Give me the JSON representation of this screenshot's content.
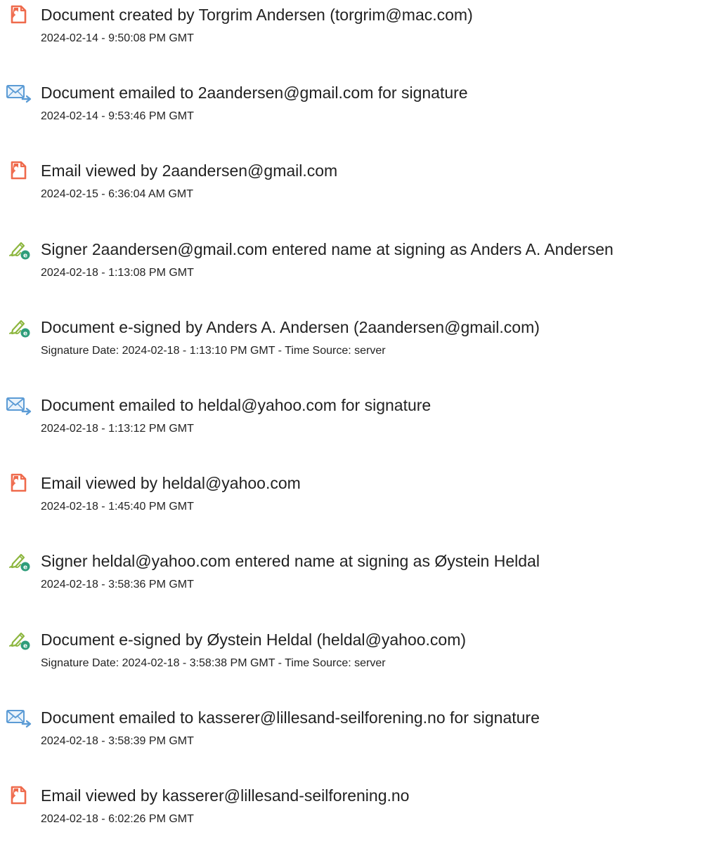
{
  "colors": {
    "doc_icon": "#ef6a4c",
    "mail_icon": "#5b9bd5",
    "sign_pen": "#8db63f",
    "sign_badge": "#2e9d7a",
    "text": "#222222"
  },
  "events": [
    {
      "icon": "document-icon",
      "title": "Document created by Torgrim Andersen (torgrim@mac.com)",
      "subtitle": "2024-02-14 - 9:50:08 PM GMT"
    },
    {
      "icon": "email-sent-icon",
      "title": "Document emailed to 2aandersen@gmail.com for signature",
      "subtitle": "2024-02-14 - 9:53:46 PM GMT"
    },
    {
      "icon": "document-icon",
      "title": "Email viewed by 2aandersen@gmail.com",
      "subtitle": "2024-02-15 - 6:36:04 AM GMT"
    },
    {
      "icon": "e-sign-icon",
      "title": "Signer 2aandersen@gmail.com entered name at signing as Anders A. Andersen",
      "subtitle": "2024-02-18 - 1:13:08 PM GMT"
    },
    {
      "icon": "e-sign-icon",
      "title": "Document e-signed by Anders A. Andersen (2aandersen@gmail.com)",
      "subtitle": "Signature Date: 2024-02-18 - 1:13:10 PM GMT - Time Source: server"
    },
    {
      "icon": "email-sent-icon",
      "title": "Document emailed to heldal@yahoo.com for signature",
      "subtitle": "2024-02-18 - 1:13:12 PM GMT"
    },
    {
      "icon": "document-icon",
      "title": "Email viewed by heldal@yahoo.com",
      "subtitle": "2024-02-18 - 1:45:40 PM GMT"
    },
    {
      "icon": "e-sign-icon",
      "title": "Signer heldal@yahoo.com entered name at signing as Øystein Heldal",
      "subtitle": "2024-02-18 - 3:58:36 PM GMT"
    },
    {
      "icon": "e-sign-icon",
      "title": "Document e-signed by Øystein Heldal (heldal@yahoo.com)",
      "subtitle": "Signature Date: 2024-02-18 - 3:58:38 PM GMT - Time Source: server"
    },
    {
      "icon": "email-sent-icon",
      "title": "Document emailed to kasserer@lillesand-seilforening.no for signature",
      "subtitle": "2024-02-18 - 3:58:39 PM GMT"
    },
    {
      "icon": "document-icon",
      "title": "Email viewed by kasserer@lillesand-seilforening.no",
      "subtitle": "2024-02-18 - 6:02:26 PM GMT"
    }
  ]
}
